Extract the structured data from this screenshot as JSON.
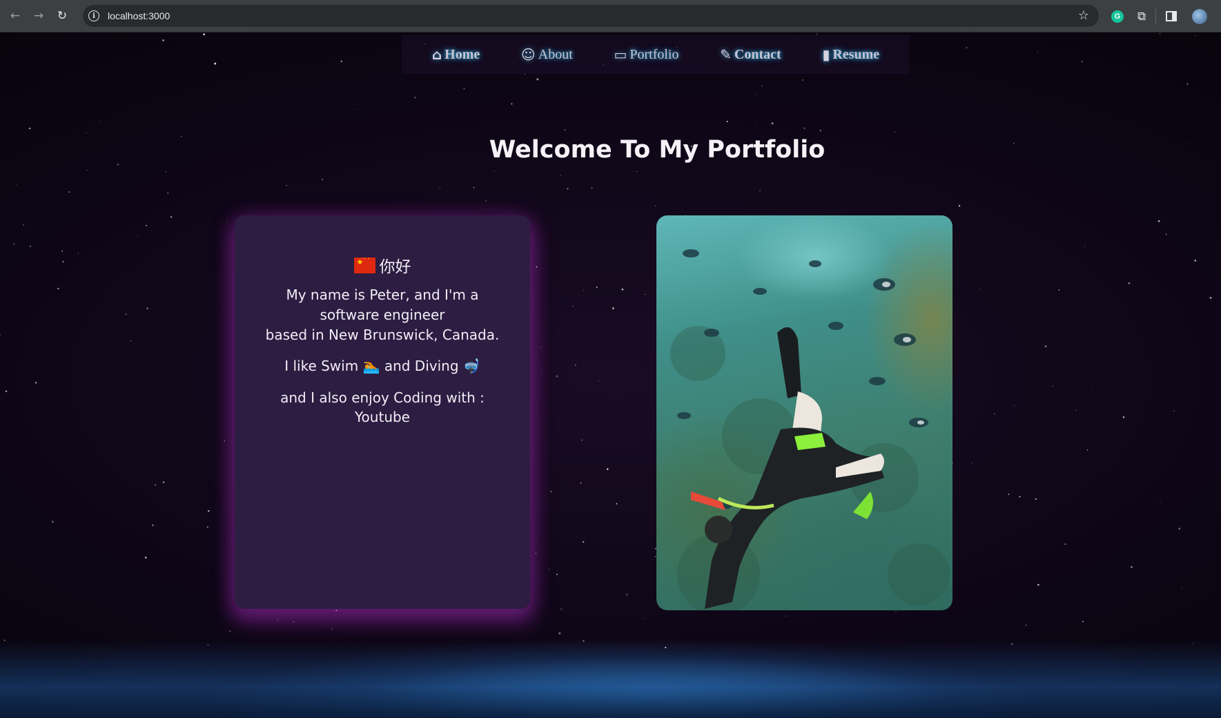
{
  "browser": {
    "url": "localhost:3000",
    "nav_icons": [
      "back-arrow-icon",
      "forward-arrow-icon",
      "reload-icon"
    ],
    "extension_badge": "G"
  },
  "navbar": {
    "items": [
      {
        "label": "Home",
        "icon": "house-icon"
      },
      {
        "label": "About",
        "icon": "user-icon"
      },
      {
        "label": "Portfolio",
        "icon": "folder-open-icon"
      },
      {
        "label": "Contact",
        "icon": "edit-icon"
      },
      {
        "label": "Resume",
        "icon": "file-icon"
      }
    ]
  },
  "hero": {
    "title": "Welcome To My Portfolio"
  },
  "intro": {
    "greeting": "你好",
    "line1": "My name is Peter, and I'm a software engineer",
    "line2": "based in New Brunswick, Canada.",
    "hobbies": "I like Swim 🏊 and Diving 🤿",
    "coding": "and I also enjoy Coding with : Youtube"
  },
  "colors": {
    "accent_glow": "#2aa7d6",
    "card_bg": "#2d1d42",
    "card_glow": "#9628aa"
  }
}
